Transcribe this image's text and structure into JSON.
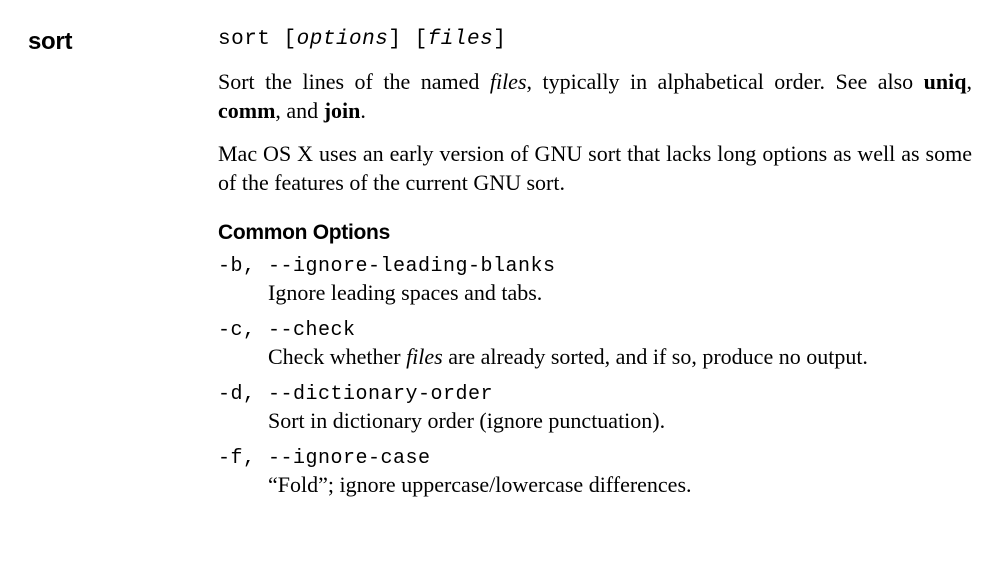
{
  "command": "sort",
  "synopsis": {
    "cmd": "sort",
    "arg1": "options",
    "arg2": "files"
  },
  "description": {
    "p1_pre": "Sort the lines of the named ",
    "p1_it": "files",
    "p1_mid": ", typically in alphabetical order. See also ",
    "p1_b1": "uniq",
    "p1_sep1": ", ",
    "p1_b2": "comm",
    "p1_sep2": ", and ",
    "p1_b3": "join",
    "p1_end": ".",
    "p2": "Mac OS X uses an early version of GNU sort that lacks long options as well as some of the features of the current GNU sort."
  },
  "section_heading": "Common Options",
  "options": {
    "b": {
      "short": "-b,",
      "long": "--ignore-leading-blanks",
      "desc": "Ignore leading spaces and tabs."
    },
    "c": {
      "short": "-c,",
      "long": "--check",
      "desc_pre": "Check whether ",
      "desc_it": "files",
      "desc_post": " are already sorted, and if so, produce no output."
    },
    "d": {
      "short": "-d,",
      "long": "--dictionary-order",
      "desc": "Sort in dictionary order (ignore punctuation)."
    },
    "f": {
      "short": "-f,",
      "long": "--ignore-case",
      "desc": "“Fold”; ignore uppercase/lowercase differences."
    }
  }
}
